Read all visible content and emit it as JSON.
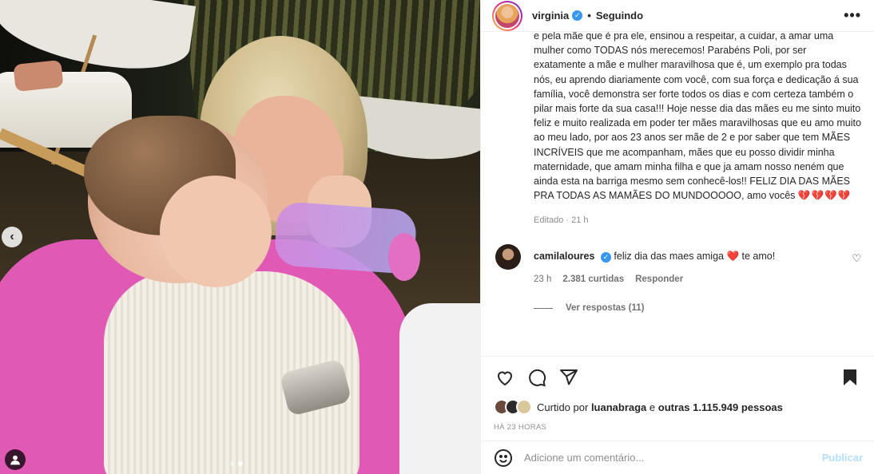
{
  "post": {
    "username": "virginia",
    "following_label": "Seguindo",
    "more_label": "•••"
  },
  "caption": {
    "text": "e pela mãe que é pra ele, ensinou a respeitar, a cuidar, a amar uma mulher como TODAS nós merecemos! Parabéns Poli, por ser exatamente a mãe e mulher maravilhosa que é, um exemplo pra todas nós, eu aprendo diariamente com você, com sua força e dedicação á sua família, você demonstra ser forte todos os dias e com certeza também o pilar mais forte da sua casa!!! Hoje nesse dia das mães eu me sinto muito feliz e muito realizada em poder ter mães maravilhosas que eu amo muito ao meu lado, por aos 23 anos ser mãe de 2 e por saber que tem MÃES INCRÍVEIS que me acompanham, mães que eu posso dividir minha maternidade, que amam minha filha e que ja amam nosso neném que ainda esta na barriga mesmo sem conhecê-los!! FELIZ DIA DAS MÃES PRA TODAS AS MAMÃES DO MUNDOOOOO, amo vocês",
    "hearts": "💔💔💔💔",
    "edited_label": "Editado · 21 h"
  },
  "comment": {
    "username": "camilaloures",
    "text_before": "feliz dia das maes amiga",
    "heart": "❤️",
    "text_after": "te amo!",
    "time": "23 h",
    "likes": "2.381 curtidas",
    "reply_label": "Responder",
    "view_replies": "Ver respostas (11)"
  },
  "likes": {
    "prefix": "Curtido por",
    "user": "luanabraga",
    "connector": "e",
    "others": "outras 1.115.949 pessoas"
  },
  "timestamp": "HÁ 23 HORAS",
  "add_comment": {
    "placeholder": "Adicione um comentário...",
    "post_label": "Publicar"
  },
  "carousel": {
    "total": 2,
    "current": 2
  },
  "icons": {
    "verified": "verified-badge-icon",
    "heart": "heart-icon",
    "comment": "comment-icon",
    "share": "share-icon",
    "save": "bookmark-icon",
    "emoji": "emoji-icon",
    "prev": "chevron-left-icon",
    "tag": "user-tag-icon"
  },
  "colors": {
    "accent": "#0095f6",
    "verified": "#3797f0",
    "post_disabled": "#b2dffc"
  }
}
